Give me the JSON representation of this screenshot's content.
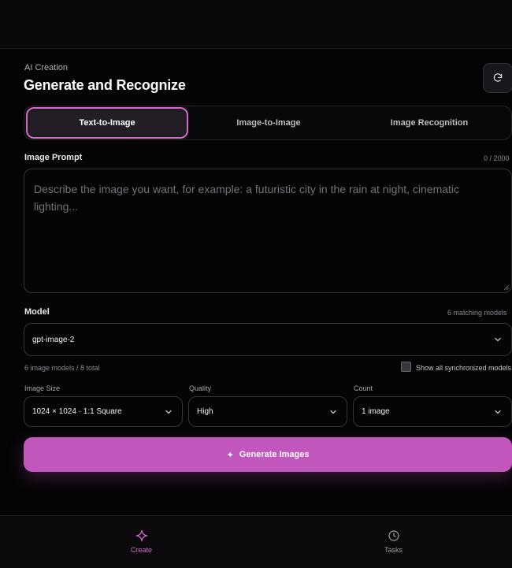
{
  "header": {
    "eyebrow": "AI Creation",
    "title": "Generate and Recognize",
    "refresh_icon": "refresh-icon"
  },
  "tabs": [
    {
      "label": "Text-to-Image",
      "active": true
    },
    {
      "label": "Image-to-Image",
      "active": false
    },
    {
      "label": "Image Recognition",
      "active": false
    }
  ],
  "prompt": {
    "label": "Image Prompt",
    "counter": "0 / 2000",
    "value": "",
    "placeholder": "Describe the image you want, for example: a futuristic city in the rain at night, cinematic lighting..."
  },
  "model": {
    "label": "Model",
    "matching": "6 matching models",
    "selected": "gpt-image-2",
    "summary": "6 image models / 8 total",
    "show_all_label": "Show all synchronized models",
    "show_all_checked": false
  },
  "options": {
    "size": {
      "label": "Image Size",
      "value": "1024 × 1024 · 1:1 Square"
    },
    "quality": {
      "label": "Quality",
      "value": "High"
    },
    "count": {
      "label": "Count",
      "value": "1 image"
    }
  },
  "generate": {
    "label": "Generate Images",
    "icon": "sparkle-icon"
  },
  "nav": [
    {
      "label": "Create",
      "icon": "sparkle-icon",
      "active": true
    },
    {
      "label": "Tasks",
      "icon": "clock-icon",
      "active": false
    }
  ],
  "colors": {
    "accent": "#c156bd",
    "accent_border": "#d26bcb",
    "background": "#050405",
    "text": "#f4f1f5"
  }
}
